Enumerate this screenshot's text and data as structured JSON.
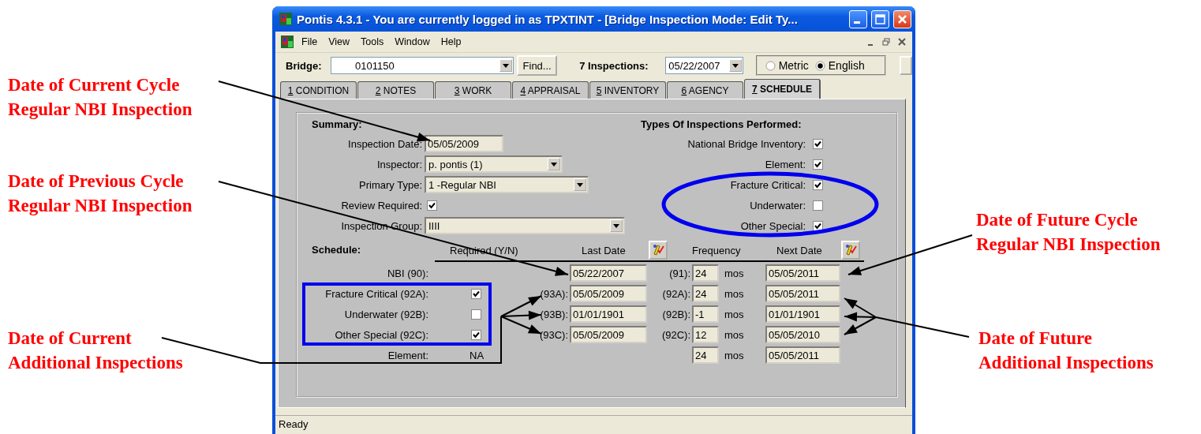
{
  "annotations": {
    "left": [
      "Date of Current Cycle\nRegular NBI Inspection",
      "Date of Previous Cycle\nRegular NBI Inspection",
      "Date of Current\nAdditional Inspections"
    ],
    "right": [
      "Date of Future Cycle\nRegular NBI Inspection",
      "Date of Future\nAdditional Inspections"
    ]
  },
  "window": {
    "title": "Pontis 4.3.1 - You are currently logged in as TPXTINT - [Bridge Inspection Mode: Edit Ty...",
    "menu": [
      "File",
      "View",
      "Tools",
      "Window",
      "Help"
    ],
    "toolbar": {
      "bridge_label": "Bridge:",
      "bridge_value": "0101150",
      "find_button": "Find...",
      "inspections_label": "7 Inspections:",
      "inspection_value": "05/22/2007",
      "units": [
        {
          "label": "Metric",
          "selected": false
        },
        {
          "label": "English",
          "selected": true
        }
      ]
    },
    "tabs": [
      {
        "label": "1 CONDITION",
        "selected": false
      },
      {
        "label": "2 NOTES",
        "selected": false
      },
      {
        "label": "3 WORK",
        "selected": false
      },
      {
        "label": "4 APPRAISAL",
        "selected": false
      },
      {
        "label": "5 INVENTORY",
        "selected": false
      },
      {
        "label": "6 AGENCY",
        "selected": false
      },
      {
        "label": "7 SCHEDULE",
        "selected": true
      }
    ],
    "summary": {
      "title": "Summary:",
      "fields": [
        {
          "label": "Inspection Date:",
          "kind": "text",
          "value": "05/05/2009"
        },
        {
          "label": "Inspector:",
          "kind": "dropdown",
          "value": "p. pontis (1)"
        },
        {
          "label": "Primary Type:",
          "kind": "dropdown",
          "value": "1 -Regular NBI"
        },
        {
          "label": "Review Required:",
          "kind": "checkbox",
          "checked": true
        },
        {
          "label": "Inspection Group:",
          "kind": "dropdown",
          "value": "IIII"
        }
      ]
    },
    "types": {
      "title": "Types Of Inspections Performed:",
      "items": [
        {
          "label": "National Bridge Inventory:",
          "checked": true
        },
        {
          "label": "Element:",
          "checked": true
        },
        {
          "label": "Fracture Critical:",
          "checked": true
        },
        {
          "label": "Underwater:",
          "checked": false
        },
        {
          "label": "Other Special:",
          "checked": true
        }
      ]
    },
    "schedule": {
      "title": "Schedule:",
      "required_header": "Required (Y/N)",
      "last_header": "Last Date",
      "frequency_header": "Frequency",
      "next_header": "Next Date",
      "rows": [
        {
          "label": "NBI (90):",
          "kind": "none",
          "last_date": "05/22/2007",
          "freq_code": "(91):",
          "frequency": "24",
          "unit": "mos",
          "next_date": "05/05/2011"
        },
        {
          "label": "Fracture Critical (92A):",
          "kind": "checkbox",
          "checked": true,
          "last_code": "(93A):",
          "last_date": "05/05/2009",
          "freq_code": "(92A):",
          "frequency": "24",
          "unit": "mos",
          "next_date": "05/05/2011"
        },
        {
          "label": "Underwater (92B):",
          "kind": "checkbox",
          "checked": false,
          "last_code": "(93B):",
          "last_date": "01/01/1901",
          "freq_code": "(92B):",
          "frequency": "-1",
          "unit": "mos",
          "next_date": "01/01/1901"
        },
        {
          "label": "Other Special (92C):",
          "kind": "checkbox",
          "checked": true,
          "last_code": "(93C):",
          "last_date": "05/05/2009",
          "freq_code": "(92C):",
          "frequency": "12",
          "unit": "mos",
          "next_date": "05/05/2010"
        },
        {
          "label": "Element:",
          "kind": "text",
          "required": "NA",
          "frequency": "24",
          "unit": "mos",
          "next_date": "05/05/2011"
        }
      ]
    },
    "status_bar": "Ready"
  }
}
